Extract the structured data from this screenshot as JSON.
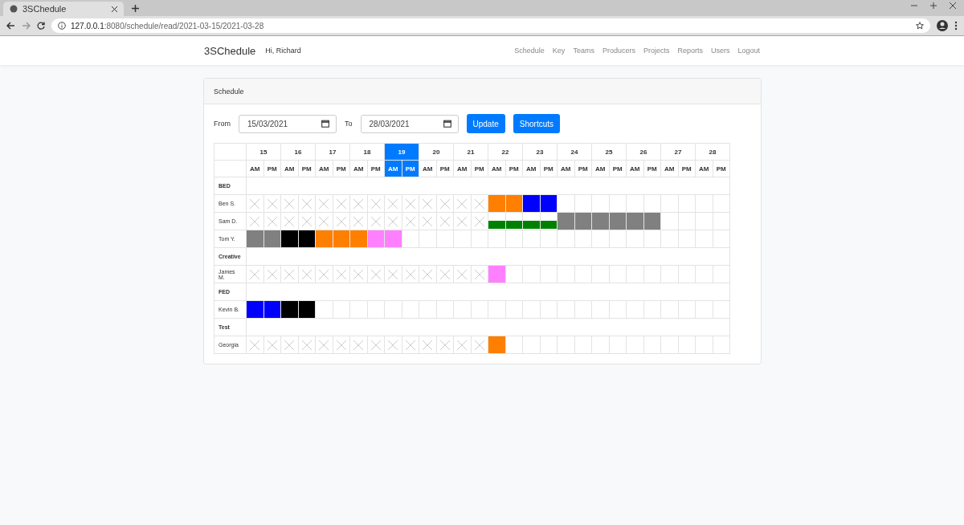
{
  "browser": {
    "tab_title": "3SChedule",
    "url": "**127.0.0.1**:8080/schedule/read/2021-03-15/2021-03-28"
  },
  "navbar": {
    "brand": "3SChedule",
    "greeting": "Hi, Richard",
    "links": [
      "Schedule",
      "Key",
      "Teams",
      "Producers",
      "Projects",
      "Reports",
      "Users",
      "Logout"
    ]
  },
  "card": {
    "title": "Schedule"
  },
  "filters": {
    "from_label": "From",
    "from_value": "15/03/2021",
    "to_label": "To",
    "to_value": "28/03/2021",
    "buttons": [
      "Update",
      "Shortcuts"
    ]
  },
  "days": [
    {
      "label": "15",
      "selected": false,
      "halves": [
        "AM",
        "PM"
      ]
    },
    {
      "label": "16",
      "selected": false,
      "halves": [
        "AM",
        "PM"
      ]
    },
    {
      "label": "17",
      "selected": false,
      "halves": [
        "AM",
        "PM"
      ]
    },
    {
      "label": "18",
      "selected": false,
      "halves": [
        "AM",
        "PM"
      ]
    },
    {
      "label": "19",
      "selected": true,
      "halves": [
        "AM",
        "PM"
      ]
    },
    {
      "label": "20",
      "selected": false,
      "halves": [
        "AM",
        "PM"
      ]
    },
    {
      "label": "21",
      "selected": false,
      "halves": [
        "AM",
        "PM"
      ]
    },
    {
      "label": "22",
      "selected": false,
      "halves": [
        "AM",
        "PM"
      ]
    },
    {
      "label": "23",
      "selected": false,
      "halves": [
        "AM",
        "PM"
      ]
    },
    {
      "label": "24",
      "selected": false,
      "halves": [
        "AM",
        "PM"
      ]
    },
    {
      "label": "25",
      "selected": false,
      "halves": [
        "AM",
        "PM"
      ]
    },
    {
      "label": "26",
      "selected": false,
      "halves": [
        "AM",
        "PM"
      ]
    },
    {
      "label": "27",
      "selected": false,
      "halves": [
        "AM",
        "PM"
      ]
    },
    {
      "label": "28",
      "selected": false,
      "halves": [
        "AM",
        "PM"
      ]
    }
  ],
  "teams": [
    {
      "name": "BED",
      "people": [
        {
          "name": "Ben S.",
          "slots": [
            {
              "kind": "past"
            },
            {
              "kind": "past"
            },
            {
              "kind": "past"
            },
            {
              "kind": "past"
            },
            {
              "kind": "past"
            },
            {
              "kind": "past"
            },
            {
              "kind": "past"
            },
            {
              "kind": "past"
            },
            {
              "kind": "past"
            },
            {
              "kind": "past"
            },
            {
              "kind": "past"
            },
            {
              "kind": "past"
            },
            {
              "kind": "past"
            },
            {
              "kind": "past"
            },
            {
              "kind": "full",
              "color": "#ff7f00"
            },
            {
              "kind": "full",
              "color": "#ff7f00"
            },
            {
              "kind": "full",
              "color": "#0000ff"
            },
            {
              "kind": "full",
              "color": "#0000ff"
            },
            {
              "kind": "empty"
            },
            {
              "kind": "empty"
            },
            {
              "kind": "empty"
            },
            {
              "kind": "empty"
            },
            {
              "kind": "empty"
            },
            {
              "kind": "empty"
            },
            {
              "kind": "empty"
            },
            {
              "kind": "empty"
            },
            {
              "kind": "empty"
            },
            {
              "kind": "empty"
            }
          ]
        },
        {
          "name": "Sam D.",
          "slots": [
            {
              "kind": "past"
            },
            {
              "kind": "past"
            },
            {
              "kind": "past"
            },
            {
              "kind": "past"
            },
            {
              "kind": "past"
            },
            {
              "kind": "past"
            },
            {
              "kind": "past"
            },
            {
              "kind": "past"
            },
            {
              "kind": "past"
            },
            {
              "kind": "past"
            },
            {
              "kind": "past"
            },
            {
              "kind": "past"
            },
            {
              "kind": "past"
            },
            {
              "kind": "past"
            },
            {
              "kind": "bar",
              "color": "#008000"
            },
            {
              "kind": "bar",
              "color": "#008000"
            },
            {
              "kind": "bar",
              "color": "#008000"
            },
            {
              "kind": "bar",
              "color": "#008000"
            },
            {
              "kind": "full",
              "color": "#808080"
            },
            {
              "kind": "full",
              "color": "#808080"
            },
            {
              "kind": "full",
              "color": "#808080"
            },
            {
              "kind": "full",
              "color": "#808080"
            },
            {
              "kind": "full",
              "color": "#808080"
            },
            {
              "kind": "full",
              "color": "#808080"
            },
            {
              "kind": "empty"
            },
            {
              "kind": "empty"
            },
            {
              "kind": "empty"
            },
            {
              "kind": "empty"
            }
          ]
        },
        {
          "name": "Tom Y.",
          "slots": [
            {
              "kind": "full",
              "color": "#808080"
            },
            {
              "kind": "full",
              "color": "#808080"
            },
            {
              "kind": "full",
              "color": "#000000"
            },
            {
              "kind": "full",
              "color": "#000000"
            },
            {
              "kind": "full",
              "color": "#ff7f00"
            },
            {
              "kind": "full",
              "color": "#ff7f00"
            },
            {
              "kind": "full",
              "color": "#ff7f00"
            },
            {
              "kind": "full",
              "color": "#ff80ff"
            },
            {
              "kind": "full",
              "color": "#ff80ff"
            },
            {
              "kind": "empty"
            },
            {
              "kind": "empty"
            },
            {
              "kind": "empty"
            },
            {
              "kind": "empty"
            },
            {
              "kind": "empty"
            },
            {
              "kind": "empty"
            },
            {
              "kind": "empty"
            },
            {
              "kind": "empty"
            },
            {
              "kind": "empty"
            },
            {
              "kind": "empty"
            },
            {
              "kind": "empty"
            },
            {
              "kind": "empty"
            },
            {
              "kind": "empty"
            },
            {
              "kind": "empty"
            },
            {
              "kind": "empty"
            },
            {
              "kind": "empty"
            },
            {
              "kind": "empty"
            },
            {
              "kind": "empty"
            },
            {
              "kind": "empty"
            }
          ]
        }
      ]
    },
    {
      "name": "Creative",
      "people": [
        {
          "name": "James M.",
          "slots": [
            {
              "kind": "past"
            },
            {
              "kind": "past"
            },
            {
              "kind": "past"
            },
            {
              "kind": "past"
            },
            {
              "kind": "past"
            },
            {
              "kind": "past"
            },
            {
              "kind": "past"
            },
            {
              "kind": "past"
            },
            {
              "kind": "past"
            },
            {
              "kind": "past"
            },
            {
              "kind": "past"
            },
            {
              "kind": "past"
            },
            {
              "kind": "past"
            },
            {
              "kind": "past"
            },
            {
              "kind": "full",
              "color": "#ff80ff"
            },
            {
              "kind": "empty"
            },
            {
              "kind": "empty"
            },
            {
              "kind": "empty"
            },
            {
              "kind": "empty"
            },
            {
              "kind": "empty"
            },
            {
              "kind": "empty"
            },
            {
              "kind": "empty"
            },
            {
              "kind": "empty"
            },
            {
              "kind": "empty"
            },
            {
              "kind": "empty"
            },
            {
              "kind": "empty"
            },
            {
              "kind": "empty"
            },
            {
              "kind": "empty"
            }
          ]
        }
      ]
    },
    {
      "name": "FED",
      "people": [
        {
          "name": "Kevin B.",
          "slots": [
            {
              "kind": "full",
              "color": "#0000ff"
            },
            {
              "kind": "full",
              "color": "#0000ff"
            },
            {
              "kind": "full",
              "color": "#000000"
            },
            {
              "kind": "full",
              "color": "#000000"
            },
            {
              "kind": "empty"
            },
            {
              "kind": "empty"
            },
            {
              "kind": "empty"
            },
            {
              "kind": "empty"
            },
            {
              "kind": "empty"
            },
            {
              "kind": "empty"
            },
            {
              "kind": "empty"
            },
            {
              "kind": "empty"
            },
            {
              "kind": "empty"
            },
            {
              "kind": "empty"
            },
            {
              "kind": "empty"
            },
            {
              "kind": "empty"
            },
            {
              "kind": "empty"
            },
            {
              "kind": "empty"
            },
            {
              "kind": "empty"
            },
            {
              "kind": "empty"
            },
            {
              "kind": "empty"
            },
            {
              "kind": "empty"
            },
            {
              "kind": "empty"
            },
            {
              "kind": "empty"
            },
            {
              "kind": "empty"
            },
            {
              "kind": "empty"
            },
            {
              "kind": "empty"
            },
            {
              "kind": "empty"
            }
          ]
        }
      ]
    },
    {
      "name": "Test",
      "people": [
        {
          "name": "Georgia",
          "slots": [
            {
              "kind": "past"
            },
            {
              "kind": "past"
            },
            {
              "kind": "past"
            },
            {
              "kind": "past"
            },
            {
              "kind": "past"
            },
            {
              "kind": "past"
            },
            {
              "kind": "past"
            },
            {
              "kind": "past"
            },
            {
              "kind": "past"
            },
            {
              "kind": "past"
            },
            {
              "kind": "past"
            },
            {
              "kind": "past"
            },
            {
              "kind": "past"
            },
            {
              "kind": "past"
            },
            {
              "kind": "full",
              "color": "#ff7f00"
            },
            {
              "kind": "empty"
            },
            {
              "kind": "empty"
            },
            {
              "kind": "empty"
            },
            {
              "kind": "empty"
            },
            {
              "kind": "empty"
            },
            {
              "kind": "empty"
            },
            {
              "kind": "empty"
            },
            {
              "kind": "empty"
            },
            {
              "kind": "empty"
            },
            {
              "kind": "empty"
            },
            {
              "kind": "empty"
            },
            {
              "kind": "empty"
            },
            {
              "kind": "empty"
            }
          ]
        }
      ]
    }
  ]
}
